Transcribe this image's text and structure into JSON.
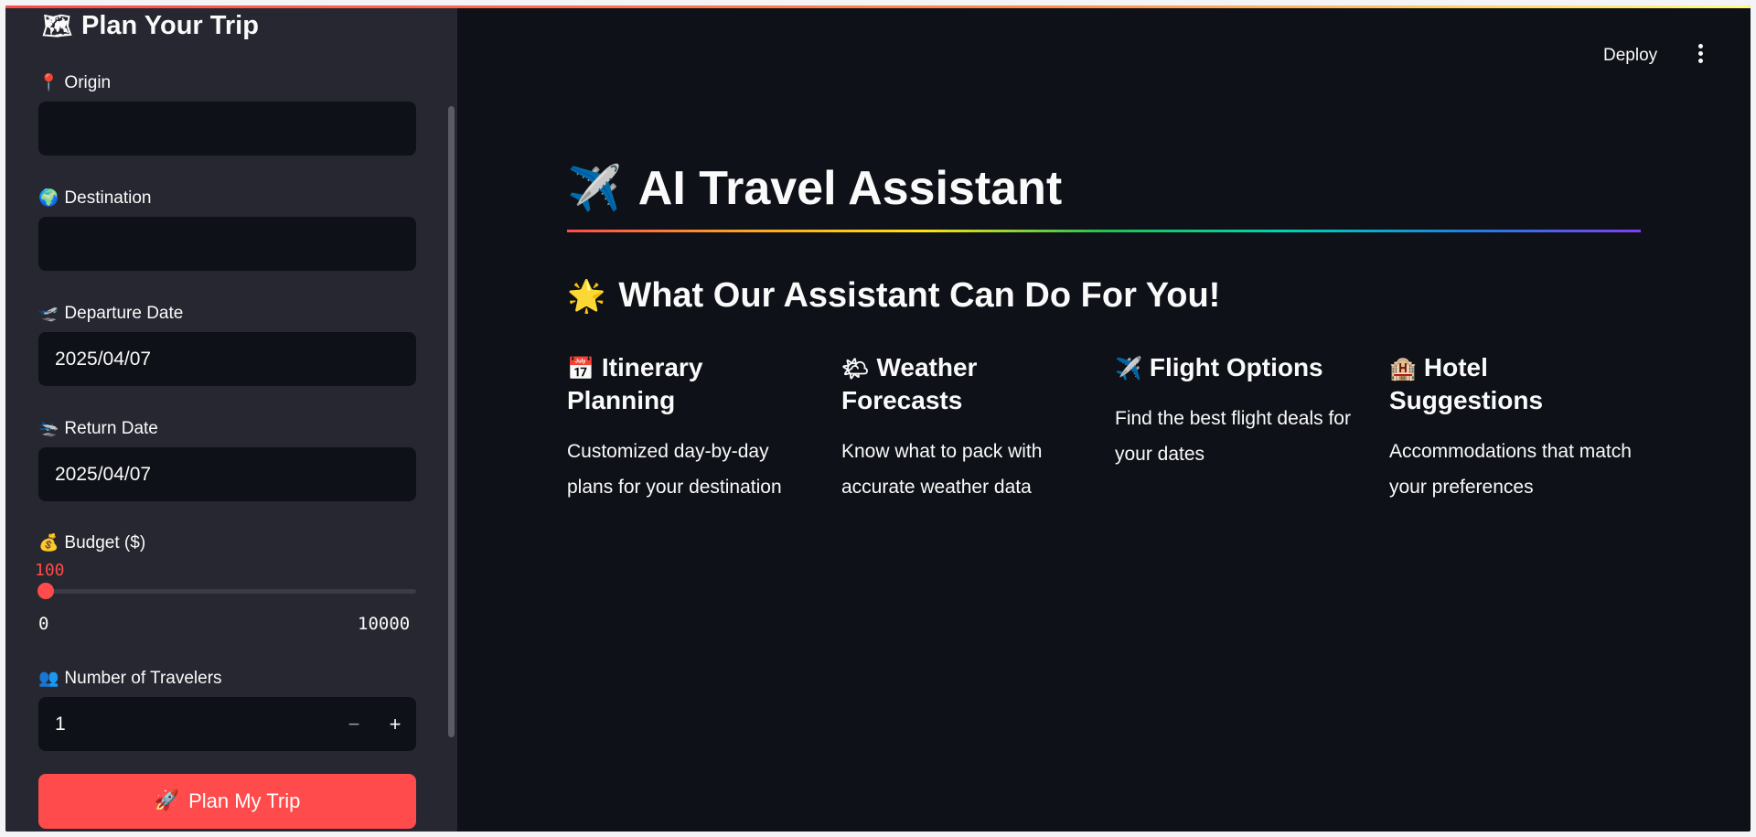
{
  "sidebar": {
    "title": "Plan Your Trip",
    "title_icon": "🗺",
    "origin": {
      "label": "Origin",
      "icon": "📍",
      "value": ""
    },
    "destination": {
      "label": "Destination",
      "icon": "🌍",
      "value": ""
    },
    "departure": {
      "label": "Departure Date",
      "icon": "🛫",
      "value": "2025/04/07"
    },
    "return": {
      "label": "Return Date",
      "icon": "🛬",
      "value": "2025/04/07"
    },
    "budget": {
      "label": "Budget ($)",
      "icon": "💰",
      "value": "100",
      "min": "0",
      "max": "10000"
    },
    "travelers": {
      "label": "Number of Travelers",
      "icon": "👥",
      "value": "1",
      "minus": "−",
      "plus": "+"
    },
    "plan_button": {
      "label": "Plan My Trip",
      "icon": "🚀"
    }
  },
  "header": {
    "deploy_label": "Deploy"
  },
  "main": {
    "title": "AI Travel Assistant",
    "title_icon": "✈️",
    "subheading": "What Our Assistant Can Do For You!",
    "subheading_icon": "🌟",
    "features": [
      {
        "icon": "📅",
        "title": "Itinerary Planning",
        "desc": "Customized day-by-day plans for your destination"
      },
      {
        "icon": "🌤",
        "title": "Weather Forecasts",
        "desc": "Know what to pack with accurate weather data"
      },
      {
        "icon": "✈️",
        "title": "Flight Options",
        "desc": "Find the best flight deals for your dates"
      },
      {
        "icon": "🏨",
        "title": "Hotel Suggestions",
        "desc": "Accommodations that match your preferences"
      }
    ]
  },
  "colors": {
    "accent": "#ff4b4b",
    "background": "#0e1117",
    "sidebar": "#262730"
  }
}
